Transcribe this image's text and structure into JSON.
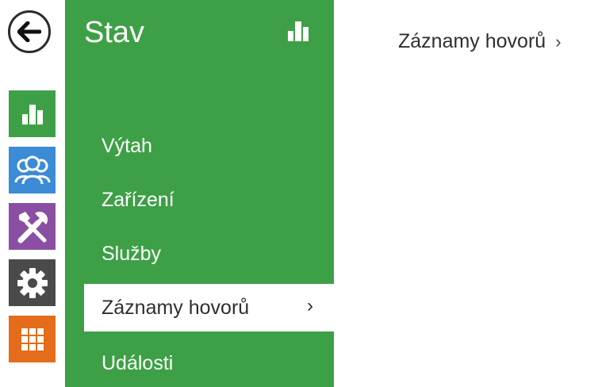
{
  "colors": {
    "green": "#3ea046",
    "blue": "#3b8bd6",
    "purple": "#8a4fa3",
    "dark_gray": "#4a4a4a",
    "orange": "#e46c1b"
  },
  "rail": {
    "back_icon": "arrow-left-icon",
    "items": [
      {
        "id": "status",
        "icon": "bar-chart-icon"
      },
      {
        "id": "users",
        "icon": "users-icon"
      },
      {
        "id": "services",
        "icon": "tools-icon"
      },
      {
        "id": "system",
        "icon": "gear-icon"
      },
      {
        "id": "apps",
        "icon": "grid-icon"
      }
    ]
  },
  "menu": {
    "title": "Stav",
    "title_icon": "bar-chart-icon",
    "items": [
      {
        "label": "Výtah"
      },
      {
        "label": "Zařízení"
      },
      {
        "label": "Služby"
      },
      {
        "label": "Záznamy hovorů",
        "chevron": "›"
      },
      {
        "label": "Události"
      }
    ]
  },
  "breadcrumb": {
    "label": "Záznamy hovorů",
    "chevron": "›"
  }
}
